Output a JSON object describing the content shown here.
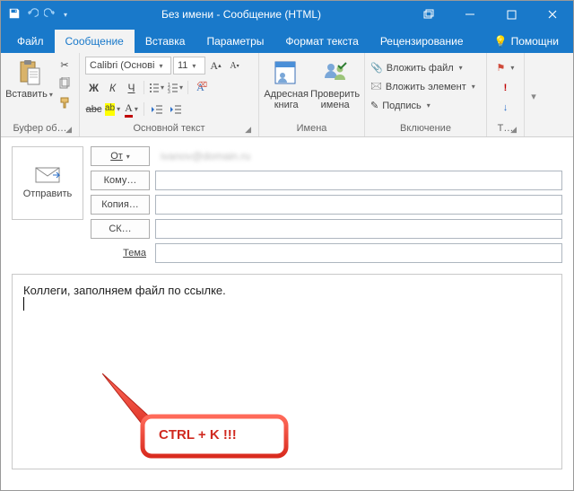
{
  "titlebar": {
    "title": "Без имени - Сообщение (HTML)"
  },
  "tabs": {
    "file": "Файл",
    "message": "Сообщение",
    "insert": "Вставка",
    "options": "Параметры",
    "format": "Формат текста",
    "review": "Рецензирование",
    "help": "Помощни"
  },
  "ribbon": {
    "clipboard": {
      "paste": "Вставить",
      "label": "Буфер об…"
    },
    "font": {
      "name": "Calibri (Основі",
      "size": "11",
      "bold": "Ж",
      "italic": "К",
      "underline": "Ч",
      "label": "Основной текст"
    },
    "names": {
      "addressbook": "Адресная\nкнига",
      "checknames": "Проверить\nимена",
      "label": "Имена"
    },
    "include": {
      "attachfile": "Вложить файл",
      "attachitem": "Вложить элемент",
      "signature": "Подпись",
      "label": "Включение"
    },
    "tags": {
      "label": "Т…"
    }
  },
  "fields": {
    "from": "От",
    "from_value": "ivanov@domain.ru",
    "to": "Кому…",
    "cc": "Копия…",
    "bcc": "СК…",
    "subject": "Тема",
    "send": "Отправить"
  },
  "body": {
    "text": "Коллеги, заполняем файл по ссылке."
  },
  "callout": {
    "text": "CTRL + K !!!"
  }
}
